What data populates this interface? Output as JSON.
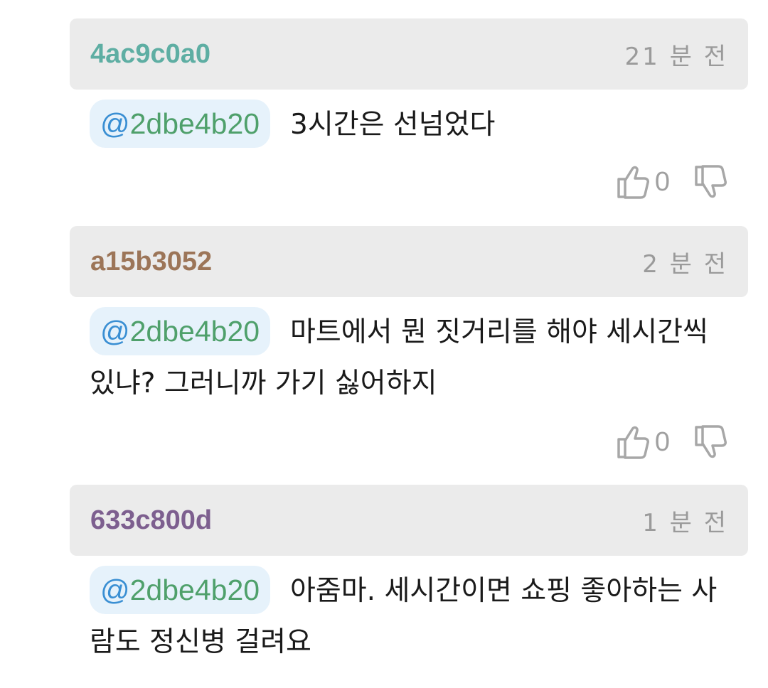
{
  "comments": [
    {
      "author": "4ac9c0a0",
      "author_color": "#5eaea3",
      "time": "21 분 전",
      "mention_at": "@",
      "mention_tag": "2dbe4b20",
      "text": "3시간은 선넘었다",
      "likes": "0",
      "like_icon": "thumbs-up-icon",
      "dislike_icon": "thumbs-down-icon"
    },
    {
      "author": "a15b3052",
      "author_color": "#9c7558",
      "time": "2 분 전",
      "mention_at": "@",
      "mention_tag": "2dbe4b20",
      "text": "마트에서 뭔 짓거리를 해야 세시간씩 있냐? 그러니까 가기 싫어하지",
      "likes": "0",
      "like_icon": "thumbs-up-icon",
      "dislike_icon": "thumbs-down-icon"
    },
    {
      "author": "633c800d",
      "author_color": "#7d5f8f",
      "time": "1 분 전",
      "mention_at": "@",
      "mention_tag": "2dbe4b20",
      "text": "아줌마. 세시간이면 쇼핑 좋아하는 사람도 정신병 걸려요"
    }
  ]
}
